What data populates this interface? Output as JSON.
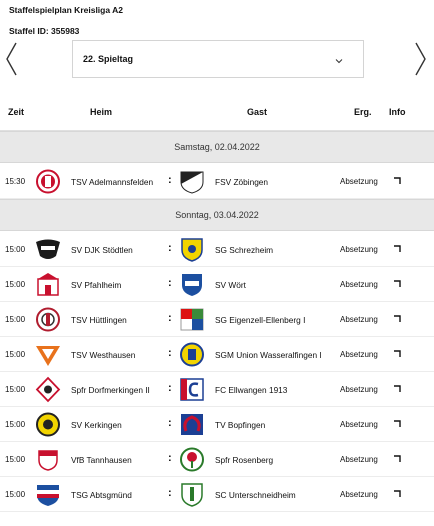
{
  "header": {
    "league_title": "Staffelspielplan Kreisliga A2",
    "staffel_id": "Staffel ID: 355983"
  },
  "matchday_select": {
    "value": "22. Spieltag"
  },
  "columns": {
    "time": "Zeit",
    "home": "Heim",
    "away": "Gast",
    "result": "Erg.",
    "info": "Info"
  },
  "days": [
    {
      "date": "Samstag, 02.04.2022",
      "matches": [
        {
          "time": "15:30",
          "home": "TSV Adelmannsfelden",
          "sep": ":",
          "away": "FSV Zöbingen",
          "status": "Absetzung"
        }
      ]
    },
    {
      "date": "Sonntag, 03.04.2022",
      "matches": [
        {
          "time": "15:00",
          "home": "SV DJK Stödtlen",
          "sep": ":",
          "away": "SG Schrezheim",
          "status": "Absetzung"
        },
        {
          "time": "15:00",
          "home": "SV Pfahlheim",
          "sep": ":",
          "away": "SV Wört",
          "status": "Absetzung"
        },
        {
          "time": "15:00",
          "home": "TSV Hüttlingen",
          "sep": ":",
          "away": "SG Eigenzell-Ellenberg I",
          "status": "Absetzung"
        },
        {
          "time": "15:00",
          "home": "TSV Westhausen",
          "sep": ":",
          "away": "SGM Union Wasseralfingen I",
          "status": "Absetzung"
        },
        {
          "time": "15:00",
          "home": "Spfr Dorfmerkingen II",
          "sep": ":",
          "away": "FC Ellwangen 1913",
          "status": "Absetzung"
        },
        {
          "time": "15:00",
          "home": "SV Kerkingen",
          "sep": ":",
          "away": "TV Bopfingen",
          "status": "Absetzung"
        },
        {
          "time": "15:00",
          "home": "VfB Tannhausen",
          "sep": ":",
          "away": "Spfr Rosenberg",
          "status": "Absetzung"
        },
        {
          "time": "15:00",
          "home": "TSG Abtsgmünd",
          "sep": ":",
          "away": "SC Unterschneidheim",
          "status": "Absetzung"
        }
      ]
    }
  ],
  "icons": {
    "prev": "chevron-left-icon",
    "next": "chevron-right-icon",
    "select": "chevron-down-icon",
    "info": "corner-arrow-icon",
    "club_logos": [
      "tsv-adelmannsfelden-logo",
      "fsv-zoebingen-logo",
      "sv-djk-stoedtlen-logo",
      "sg-schrezheim-logo",
      "sv-pfahlheim-logo",
      "sv-woert-logo",
      "tsv-huettlingen-logo",
      "sg-eigenzell-ellenberg-logo",
      "tsv-westhausen-logo",
      "sgm-union-wasseralfingen-logo",
      "spfr-dorfmerkingen-logo",
      "fc-ellwangen-logo",
      "sv-kerkingen-logo",
      "tv-bopfingen-logo",
      "vfb-tannhausen-logo",
      "spfr-rosenberg-logo",
      "tsg-abtsgmuend-logo",
      "sc-unterschneidheim-logo"
    ]
  },
  "colors": {
    "date_row_bg": "#e8e8e8",
    "border": "#d4d4d4"
  }
}
